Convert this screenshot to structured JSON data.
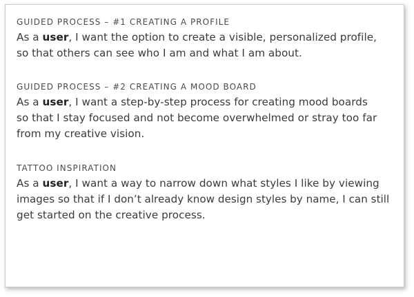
{
  "stories": [
    {
      "heading": "GUIDED PROCESS – #1 CREATING A PROFILE",
      "prefix": "As a ",
      "role": "user",
      "line1_rest": ", I want the option to create a visible, personalized profile,",
      "lines": [
        "so that others can see who I am and what I am about."
      ]
    },
    {
      "heading": "GUIDED PROCESS – #2 CREATING A MOOD BOARD",
      "prefix": "As a ",
      "role": "user",
      "line1_rest": ", I want a step-by-step process for creating mood boards",
      "lines": [
        "so that I stay focused and not become overwhelmed or stray too far",
        "from my creative vision."
      ]
    },
    {
      "heading": "TATTOO INSPIRATION",
      "prefix": "As a ",
      "role": "user",
      "line1_rest": ", I want a way to narrow down what styles I like by viewing",
      "lines": [
        "images so that if I don’t already know design styles by name, I can still",
        "get started on the creative process."
      ]
    }
  ]
}
